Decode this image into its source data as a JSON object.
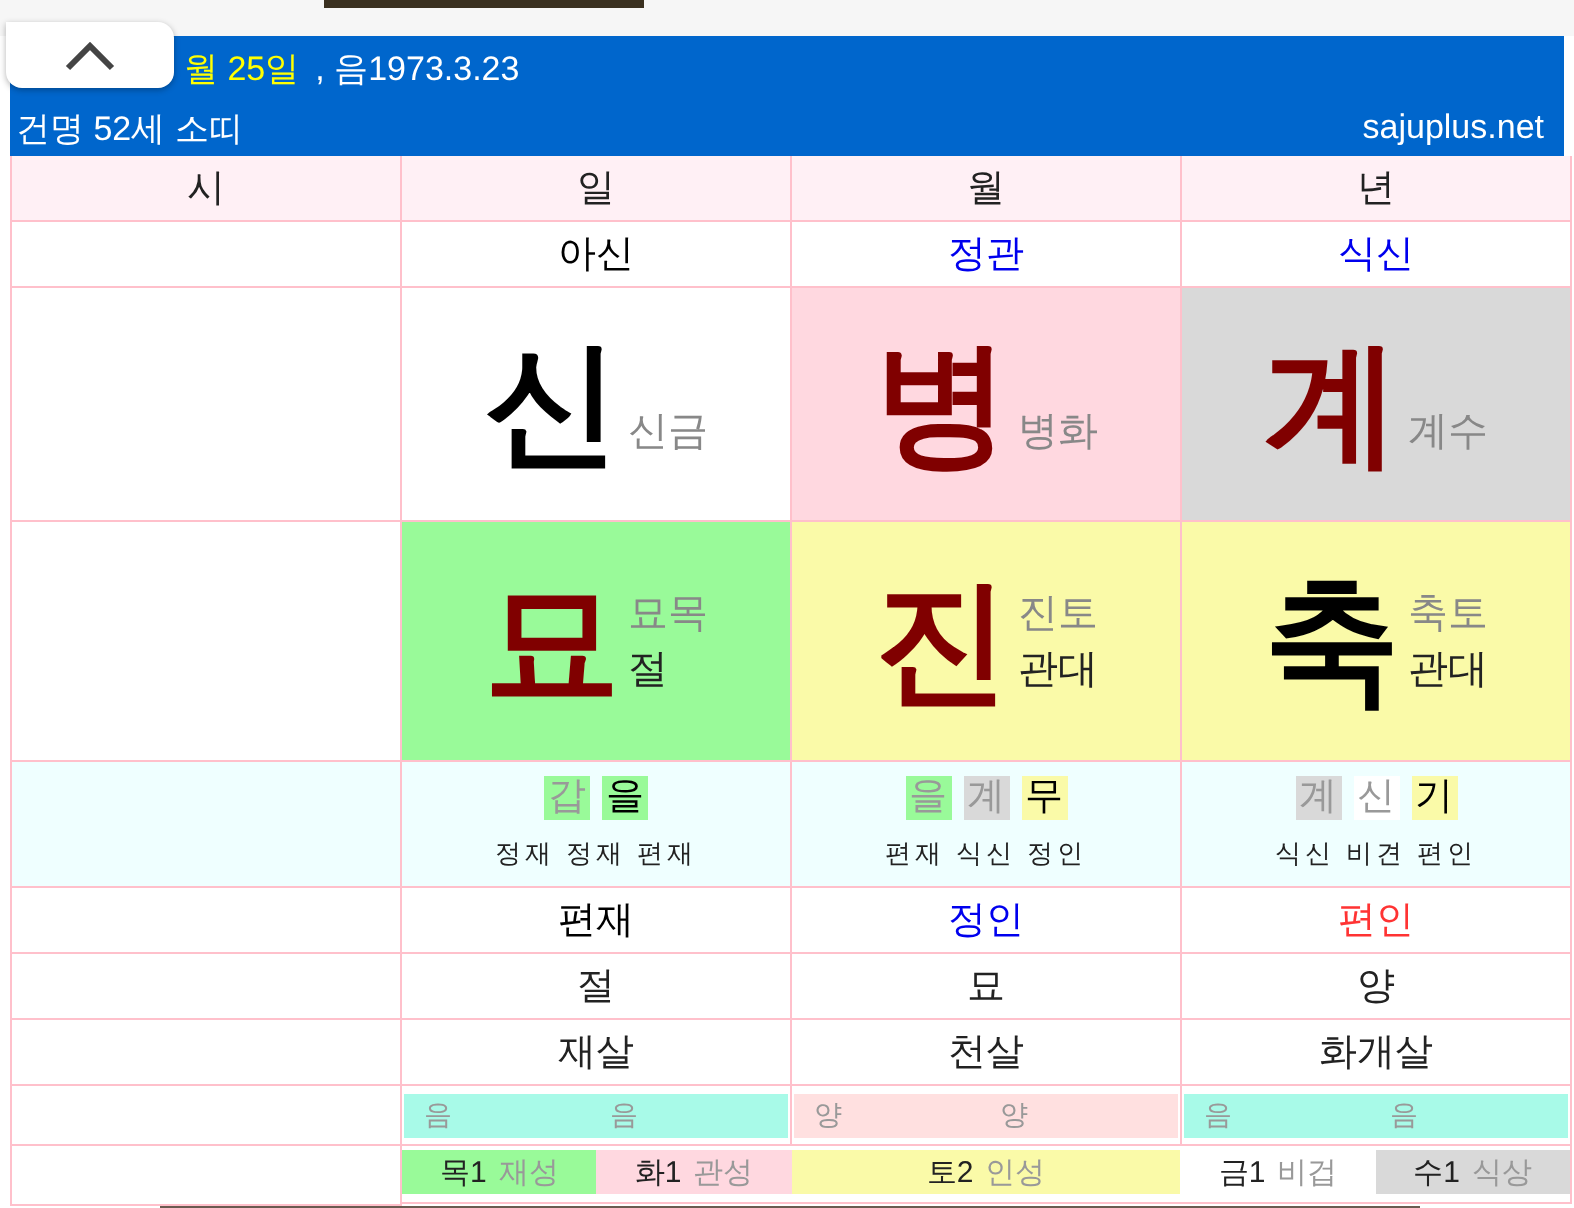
{
  "header": {
    "date_part": "월 25일",
    "lunar_part": ", 음1973.3.23",
    "person": "건명 52세 소띠",
    "site": "sajuplus.net"
  },
  "columns": [
    "시",
    "일",
    "월",
    "년"
  ],
  "sipsin_top": [
    {
      "text": "아신",
      "color": "#000000"
    },
    {
      "text": "정관",
      "color": "#0000ee"
    },
    {
      "text": "식신",
      "color": "#0000ee"
    }
  ],
  "stems": [
    {
      "char": "신",
      "sub": "신금",
      "red": false,
      "color": "#ffffff"
    },
    {
      "char": "병",
      "sub": "병화",
      "red": true,
      "color": "#ffd8e0"
    },
    {
      "char": "계",
      "sub": "계수",
      "red": true,
      "color": "#d9d9d9"
    }
  ],
  "branches": [
    {
      "char": "묘",
      "sub": "묘목",
      "stage": "절",
      "red": true,
      "color": "#99fa99"
    },
    {
      "char": "진",
      "sub": "진토",
      "stage": "관대",
      "red": true,
      "color": "#fafaa8"
    },
    {
      "char": "축",
      "sub": "축토",
      "stage": "관대",
      "red": false,
      "color": "#fafaa8"
    }
  ],
  "hidden_stems": [
    {
      "chars": [
        {
          "text": "갑",
          "color": "#99fa99",
          "active": false
        },
        {
          "text": "을",
          "color": "#99fa99",
          "active": true
        }
      ],
      "gods": "정재 정재 편재"
    },
    {
      "chars": [
        {
          "text": "을",
          "color": "#99fa99",
          "active": false
        },
        {
          "text": "계",
          "color": "#d9d9d9",
          "active": false
        },
        {
          "text": "무",
          "color": "#fafaa8",
          "active": true
        }
      ],
      "gods": "편재 식신 정인"
    },
    {
      "chars": [
        {
          "text": "계",
          "color": "#d9d9d9",
          "active": false
        },
        {
          "text": "신",
          "color": "#ffffff",
          "active": false
        },
        {
          "text": "기",
          "color": "#fafaa8",
          "active": true
        }
      ],
      "gods": "식신 비견 편인"
    }
  ],
  "sipsin_bottom": [
    {
      "text": "편재",
      "color": "#000000"
    },
    {
      "text": "정인",
      "color": "#0000ee"
    },
    {
      "text": "편인",
      "color": "#ff3333"
    }
  ],
  "stages": [
    "절",
    "묘",
    "양"
  ],
  "spirits": [
    "재살",
    "천살",
    "화개살"
  ],
  "yinyang": [
    {
      "left": "음",
      "right": "음",
      "color": "#a8fae8"
    },
    {
      "left": "양",
      "right": "양",
      "color": "#ffe0e0"
    },
    {
      "left": "음",
      "right": "음",
      "color": "#a8fae8"
    }
  ],
  "elements": [
    {
      "name": "목1",
      "role": "재성",
      "color": "#99fa99"
    },
    {
      "name": "화1",
      "role": "관성",
      "color": "#ffd8e0"
    },
    {
      "name": "토2",
      "role": "인성",
      "color": "#fafaa8"
    },
    {
      "name": "금1",
      "role": "비겁",
      "color": "#ffffff"
    },
    {
      "name": "수1",
      "role": "식상",
      "color": "#d9d9d9"
    }
  ]
}
